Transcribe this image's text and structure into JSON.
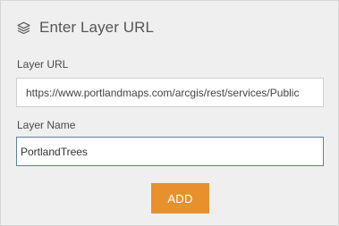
{
  "dialog": {
    "title": "Enter Layer URL",
    "title_icon": "layers-icon"
  },
  "form": {
    "layer_url": {
      "label": "Layer URL",
      "value": "https://www.portlandmaps.com/arcgis/rest/services/Public"
    },
    "layer_name": {
      "label": "Layer Name",
      "value": "PortlandTrees"
    },
    "add_label": "ADD"
  },
  "colors": {
    "accent": "#e8902c",
    "panel_background": "#efefef",
    "focus_border": "#5b7fa8"
  }
}
